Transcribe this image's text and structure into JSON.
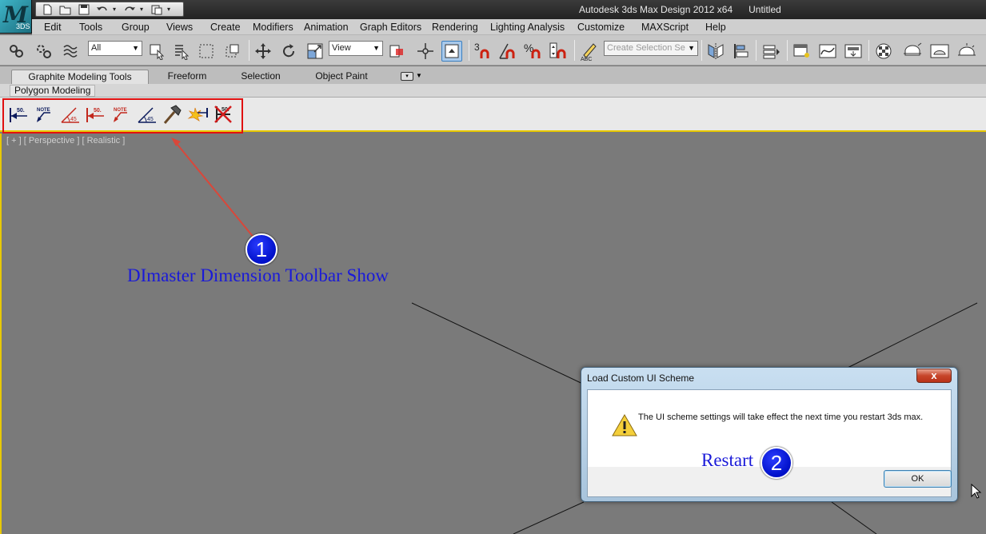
{
  "window": {
    "title": "Autodesk 3ds Max Design 2012 x64      Untitled",
    "app_version_badge": "3DS"
  },
  "quick_access": {
    "icons": [
      "new-file-icon",
      "open-folder-icon",
      "save-icon",
      "undo-icon",
      "redo-icon",
      "project-folder-icon"
    ]
  },
  "menu": {
    "items": [
      "Edit",
      "Tools",
      "Group",
      "Views",
      "Create",
      "Modifiers",
      "Animation",
      "Graph Editors",
      "Rendering",
      "Lighting Analysis",
      "Customize",
      "MAXScript",
      "Help"
    ]
  },
  "toolbar": {
    "selection_filter": "All",
    "reference_coord": "View",
    "named_selection_placeholder": "Create Selection Se"
  },
  "ribbon": {
    "tabs": [
      "Graphite Modeling Tools",
      "Freeform",
      "Selection",
      "Object Paint"
    ],
    "active_tab": "Graphite Modeling Tools",
    "panel_label": "Polygon Modeling"
  },
  "dimaster_toolbar": {
    "buttons": [
      "linear-dimension-icon",
      "note-leader-icon",
      "angle-dimension-icon",
      "linear-dimension-red-icon",
      "note-leader-red-icon",
      "angle-dimension-45-icon",
      "hammer-icon",
      "explode-dimension-icon",
      "delete-dimension-icon"
    ],
    "labels": {
      "dim_value": "50.",
      "note": "NOTE",
      "angle": "45"
    }
  },
  "viewport": {
    "label": "[ + ] [ Perspective ] [ Realistic ]"
  },
  "annotations": {
    "callout_1_number": "1",
    "callout_1_text": "DImaster Dimension Toolbar Show",
    "callout_2_number": "2",
    "callout_2_text": "Restart",
    "colors": {
      "highlight": "#e01010",
      "badge": "#0010c8",
      "text": "#1a1ad8",
      "arrow": "#d9473a"
    }
  },
  "dialog": {
    "title": "Load Custom UI Scheme",
    "close_label": "x",
    "message": "The UI scheme settings will take effect the next time you restart 3ds max.",
    "ok_label": "OK"
  }
}
